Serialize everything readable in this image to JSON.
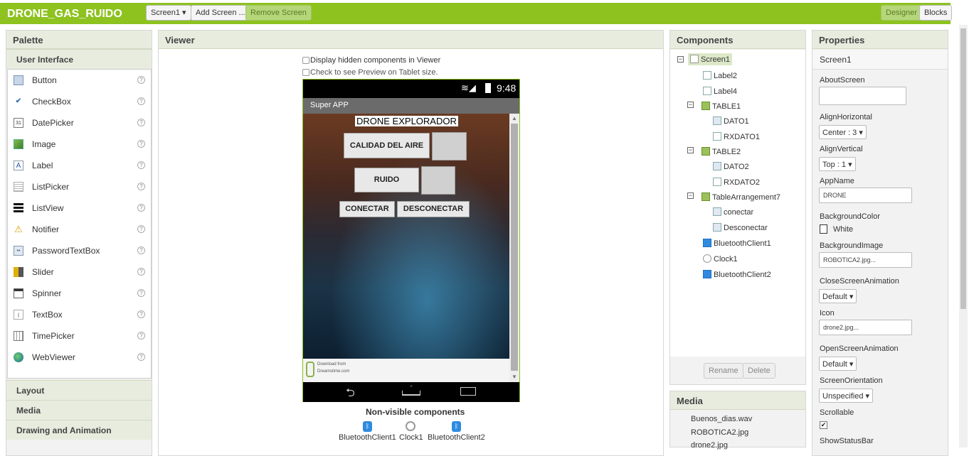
{
  "app": {
    "title": "DRONE_GAS_RUIDO"
  },
  "toolbar": {
    "screen_select": "Screen1 ▾",
    "add_screen": "Add Screen ...",
    "remove_screen": "Remove Screen",
    "designer": "Designer",
    "blocks": "Blocks"
  },
  "palette": {
    "title": "Palette",
    "open_category": "User Interface",
    "items": [
      "Button",
      "CheckBox",
      "DatePicker",
      "Image",
      "Label",
      "ListPicker",
      "ListView",
      "Notifier",
      "PasswordTextBox",
      "Slider",
      "Spinner",
      "TextBox",
      "TimePicker",
      "WebViewer"
    ],
    "categories": [
      "Layout",
      "Media",
      "Drawing and Animation"
    ]
  },
  "viewer": {
    "title": "Viewer",
    "display_hidden": "Display hidden components in Viewer",
    "tablet_preview": "Check to see Preview on Tablet size.",
    "phone": {
      "time": "9:48",
      "app_title": "Super APP",
      "heading": "DRONE EXPLORADOR",
      "btn_air": "CALIDAD DEL AIRE",
      "btn_noise": "RUIDO",
      "btn_connect": "CONECTAR",
      "btn_disconnect": "DESCONECTAR",
      "ad_line1": "Download from",
      "ad_line2": "Dreamstime.com"
    },
    "nonvisible_title": "Non-visible components",
    "nonvisible": [
      "BluetoothClient1",
      "Clock1",
      "BluetoothClient2"
    ]
  },
  "components": {
    "title": "Components",
    "tree": [
      "Screen1",
      "Label2",
      "Label4",
      "TABLE1",
      "DATO1",
      "RXDATO1",
      "TABLE2",
      "DATO2",
      "RXDATO2",
      "TableArrangement7",
      "conectar",
      "Desconectar",
      "BluetoothClient1",
      "Clock1",
      "BluetoothClient2"
    ],
    "rename": "Rename",
    "delete": "Delete"
  },
  "media": {
    "title": "Media",
    "files": [
      "Buenos_dias.wav",
      "ROBOTICA2.jpg",
      "drone2.jpg"
    ]
  },
  "properties": {
    "title": "Properties",
    "screen_name": "Screen1",
    "about_label": "AboutScreen",
    "about_value": "",
    "align_h_label": "AlignHorizontal",
    "align_h_value": "Center : 3 ▾",
    "align_v_label": "AlignVertical",
    "align_v_value": "Top : 1 ▾",
    "appname_label": "AppName",
    "appname_value": "DRONE",
    "bgcolor_label": "BackgroundColor",
    "bgcolor_value": "White",
    "bgimage_label": "BackgroundImage",
    "bgimage_value": "ROBOTICA2.jpg...",
    "close_anim_label": "CloseScreenAnimation",
    "close_anim_value": "Default ▾",
    "icon_label": "Icon",
    "icon_value": "drone2.jpg...",
    "open_anim_label": "OpenScreenAnimation",
    "open_anim_value": "Default ▾",
    "orientation_label": "ScreenOrientation",
    "orientation_value": "Unspecified ▾",
    "scrollable_label": "Scrollable",
    "statusbar_label": "ShowStatusBar"
  },
  "colors": {
    "accent": "#8dc21f",
    "panel_header": "#e8ecdf"
  }
}
